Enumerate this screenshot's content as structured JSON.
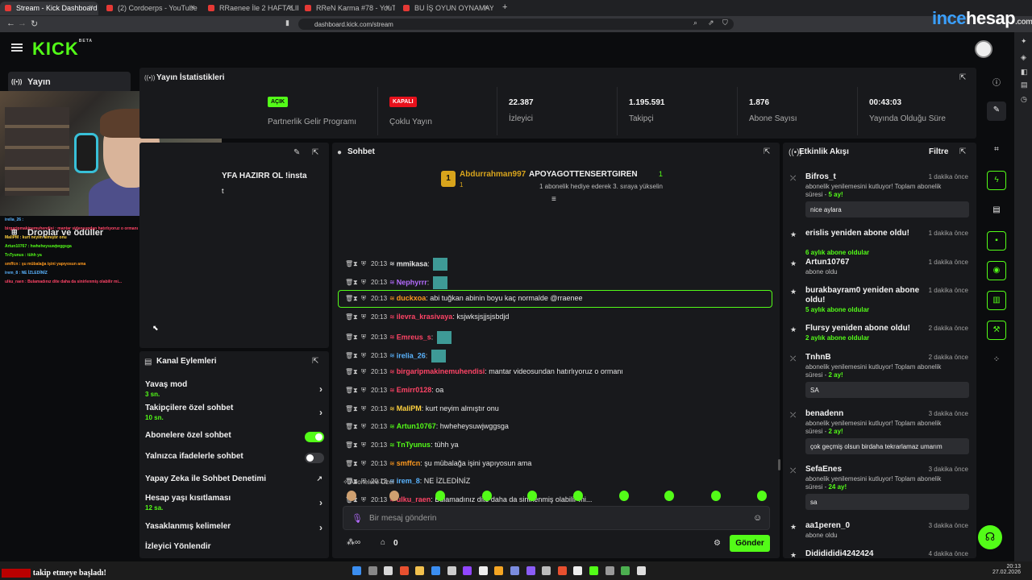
{
  "browser": {
    "tabs": [
      {
        "label": "Stream - Kick Dashboard",
        "active": true
      },
      {
        "label": "(2) Cordoerps - YouTube"
      },
      {
        "label": "RRaenee İle 2 HAFTALIK KOMİK AN..."
      },
      {
        "label": "RReN Karma #78 - YouTube"
      },
      {
        "label": "BU İŞ OYUN OYNAMAYA BENZEMİ..."
      }
    ],
    "url": "dashboard.kick.com/stream",
    "watermark_a": "ince",
    "watermark_b": "hesap",
    "watermark_c": ".com"
  },
  "header": {
    "logo": "KICK",
    "beta": "BETA"
  },
  "sidebar": {
    "items": [
      {
        "label": "Yayın",
        "icon": "broadcast-icon"
      },
      {
        "label": "Droplar ve ödüller",
        "icon": "gift-icon"
      }
    ]
  },
  "overlay_chat": [
    "irelia_26 :",
    "birgaripmakinemuhendisi : mantar videosundan hatırlıyoruz o ormanı",
    "MaliPM : kurt neyim almıştır onu",
    "Artun10767 : hwheheysuwjwggsga",
    "TnTyunus : tühh ya",
    "smffcn : şu mübalağa işini yapıyosun ama",
    "irem_8 : NE İZLEDİNİZ",
    "ulku_raen : Bulamadınız dite daha da sinirlenmiş olabilir mi..."
  ],
  "stats": {
    "title": "Yayın İstatistikleri",
    "items": [
      {
        "badge": "AÇIK",
        "label": "Partnerlik Gelir Programı",
        "color": "#53fc18"
      },
      {
        "badge": "KAPALI",
        "label": "Çoklu Yayın",
        "color": "#e8111c"
      },
      {
        "value": "22.387",
        "label": "İzleyici"
      },
      {
        "value": "1.195.591",
        "label": "Takipçi"
      },
      {
        "value": "1.876",
        "label": "Abone Sayısı"
      },
      {
        "value": "00:43:03",
        "label": "Yayında Olduğu Süre"
      }
    ]
  },
  "stream_info": {
    "title_fragment": "YFA HAZIRR OL !insta",
    "line2": "t"
  },
  "chat": {
    "title": "Sohbet",
    "pinned": {
      "gift_count": "1",
      "gifter": "Abdurrahman997",
      "gifter_count": "1",
      "recipient": "APOYAGOTTENSERTGIREN",
      "recipient_count": "1",
      "text": "1 abonelik hediye ederek 3. sıraya yükselin"
    },
    "messages": [
      {
        "time": "20:13",
        "user": "mmikasa",
        "text": "",
        "color": "#e5e5e5",
        "emote": true
      },
      {
        "time": "20:13",
        "user": "Nephyrrr",
        "text": "",
        "color": "#b56cff",
        "emote": true
      },
      {
        "time": "20:13",
        "user": "duckxoa",
        "text": "abi tuğkan abinin boyu kaç normalde @rraenee",
        "color": "#ff9a1f",
        "highlight": true
      },
      {
        "time": "20:13",
        "user": "ilevra_krasivaya",
        "text": "ksjwksjsjjsjsbdjd",
        "color": "#ff4466"
      },
      {
        "time": "20:13",
        "user": "Emreus_s",
        "text": "",
        "color": "#ff4466",
        "emote": true
      },
      {
        "time": "20:13",
        "user": "irelia_26",
        "text": "",
        "color": "#5ab4ff",
        "emote": true
      },
      {
        "time": "20:13",
        "user": "birgaripmakinemuhendisi",
        "text": "mantar videosundan hatırlıyoruz o ormanı",
        "color": "#ff4466"
      },
      {
        "time": "20:13",
        "user": "Emirr0128",
        "text": "oa",
        "color": "#ff4466"
      },
      {
        "time": "20:13",
        "user": "MaliPM",
        "text": "kurt neyim almıştır onu",
        "color": "#ffd23f"
      },
      {
        "time": "20:13",
        "user": "Artun10767",
        "text": "hwheheysuwjwggsga",
        "color": "#53fc18"
      },
      {
        "time": "20:13",
        "user": "TnTyunus",
        "text": "tühh ya",
        "color": "#53fc18"
      },
      {
        "time": "20:13",
        "user": "smffcn",
        "text": "şu mübalağa işini yapıyosun ama",
        "color": "#ff9a1f"
      },
      {
        "time": "20:13",
        "user": "irem_8",
        "text": "NE İZLEDİNİZ",
        "color": "#5ab4ff"
      },
      {
        "time": "20:13",
        "user": "ulku_raen",
        "text": "Bulamadınız dite daha da sinirlenmiş olabilir mi...",
        "color": "#ff4466"
      }
    ],
    "emote_section": "Abonelere Özel",
    "input_placeholder": "Bir mesaj gönderin",
    "points": "0",
    "send_label": "Gönder"
  },
  "actions": {
    "title": "Kanal Eylemleri",
    "items": [
      {
        "label": "Yavaş mod",
        "sub": "3 sn.",
        "type": "chevron"
      },
      {
        "label": "Takipçilere özel sohbet",
        "sub": "10 sn.",
        "type": "chevron"
      },
      {
        "label": "Abonelere özel sohbet",
        "type": "toggle",
        "on": true
      },
      {
        "label": "Yalnızca ifadelerle sohbet",
        "type": "toggle",
        "on": false
      },
      {
        "label": "Yapay Zeka ile Sohbet Denetimi",
        "type": "link"
      },
      {
        "label": "Hesap yaşı kısıtlaması",
        "sub": "12 sa.",
        "type": "chevron"
      },
      {
        "label": "Yasaklanmış kelimeler",
        "type": "chevron"
      },
      {
        "label": "İzleyici Yönlendir",
        "type": "none"
      }
    ]
  },
  "activity": {
    "title": "Etkinlik Akışı",
    "filter": "Filtre",
    "events": [
      {
        "name": "Bifros_t",
        "time": "1 dakika önce",
        "desc": "abonelik yenilemesini kutluyor! Toplam abonelik süresi - ",
        "dur": "5 ay!",
        "msg": "nice aylara"
      },
      {
        "name": "erislis yeniden abone oldu!",
        "time": "1 dakika önce",
        "desc": "",
        "dur": "6 aylık abone oldular"
      },
      {
        "name": "Artun10767",
        "time": "1 dakika önce",
        "desc": "abone oldu"
      },
      {
        "name": "burakbayram0 yeniden abone oldu!",
        "time": "1 dakika önce",
        "desc": "",
        "dur": "5 aylık abone oldular"
      },
      {
        "name": "Flursy yeniden abone oldu!",
        "time": "2 dakika önce",
        "desc": "",
        "dur": "2 aylık abone oldular"
      },
      {
        "name": "TnhnB",
        "time": "2 dakika önce",
        "desc": "abonelik yenilemesini kutluyor! Toplam abonelik süresi - ",
        "dur": "2 ay!",
        "msg": "SA"
      },
      {
        "name": "benadenn",
        "time": "3 dakika önce",
        "desc": "abonelik yenilemesini kutluyor! Toplam abonelik süresi - ",
        "dur": "2 ay!",
        "msg": "çok geçmiş olsun birdaha tekrarlamaz umarım"
      },
      {
        "name": "SefaEnes",
        "time": "3 dakika önce",
        "desc": "abonelik yenilemesini kutluyor! Toplam abonelik süresi - ",
        "dur": "24 ay!",
        "msg": "sa"
      },
      {
        "name": "aa1peren_0",
        "time": "3 dakika önce",
        "desc": "abone oldu"
      },
      {
        "name": "Dididididi4242424",
        "time": "4 dakika önce",
        "desc": ""
      }
    ]
  },
  "stream_alert": "takip etmeye başladı!",
  "taskbar": {
    "time": "20:13",
    "date": "27.02.2026"
  }
}
